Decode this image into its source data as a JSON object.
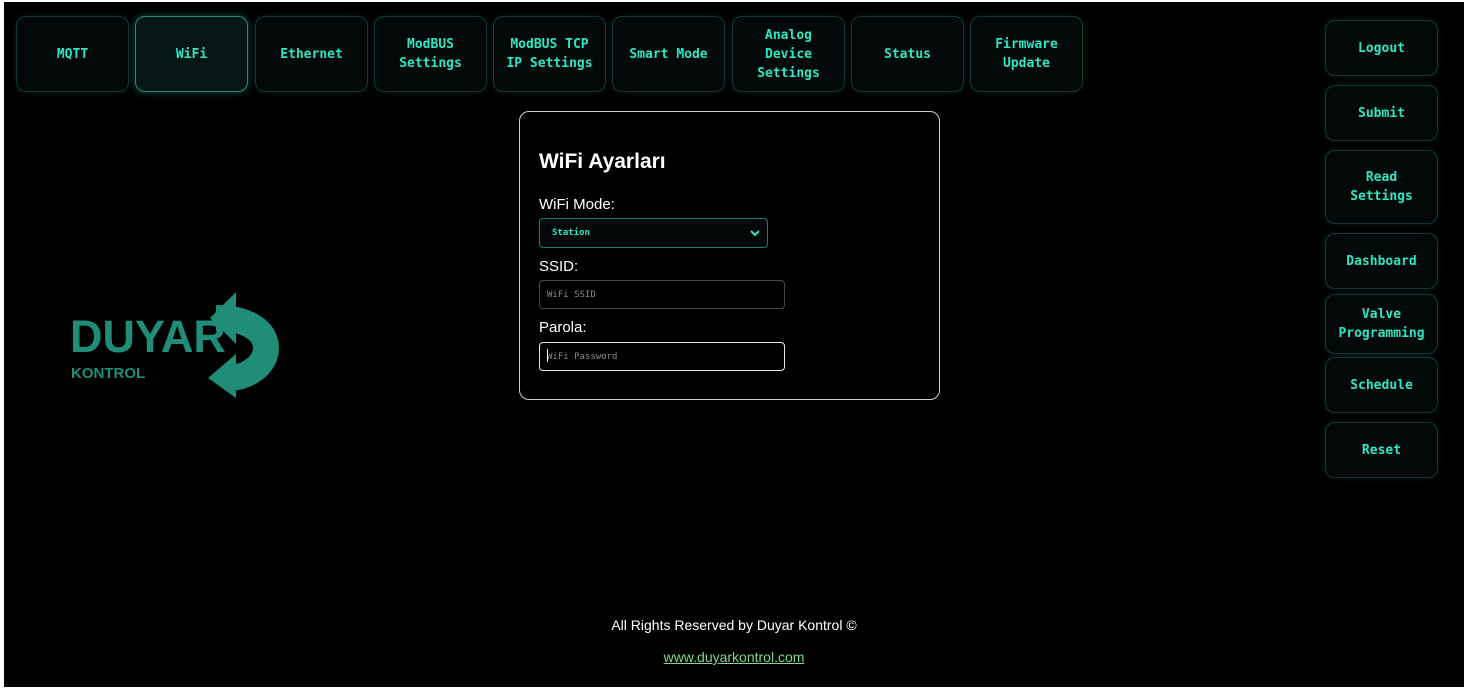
{
  "nav": {
    "tabs": [
      {
        "label": "MQTT"
      },
      {
        "label": "WiFi"
      },
      {
        "label": "Ethernet"
      },
      {
        "label": "ModBUS\nSettings"
      },
      {
        "label": "ModBUS TCP\nIP Settings"
      },
      {
        "label": "Smart Mode"
      },
      {
        "label": "Analog\nDevice\nSettings"
      },
      {
        "label": "Status"
      },
      {
        "label": "Firmware\nUpdate"
      }
    ],
    "active_tab": "WiFi"
  },
  "sidebar": {
    "buttons": [
      {
        "label": "Logout"
      },
      {
        "label": "Submit"
      },
      {
        "label": "Read\nSettings"
      },
      {
        "label": "Dashboard"
      },
      {
        "label": "Valve\nProgramming"
      },
      {
        "label": "Schedule"
      },
      {
        "label": "Reset"
      }
    ]
  },
  "form": {
    "title": "WiFi Ayarları",
    "mode_label": "WiFi Mode:",
    "mode_value": "Station",
    "ssid_label": "SSID:",
    "ssid_placeholder": "WiFi SSID",
    "password_label": "Parola:",
    "password_placeholder": "WiFi Password"
  },
  "logo": {
    "name": "DUYAR",
    "sub": "KONTROL"
  },
  "footer": {
    "copyright": "All Rights Reserved by Duyar Kontrol ©",
    "link": "www.duyarkontrol.com"
  },
  "colors": {
    "accent": "#2ee6c3",
    "brand": "#1f8d78",
    "link": "#7fd88a",
    "background": "#000000"
  },
  "icons": {
    "logo_arrow": "circular-arrow-icon",
    "select_chevron": "chevron-down-icon"
  }
}
